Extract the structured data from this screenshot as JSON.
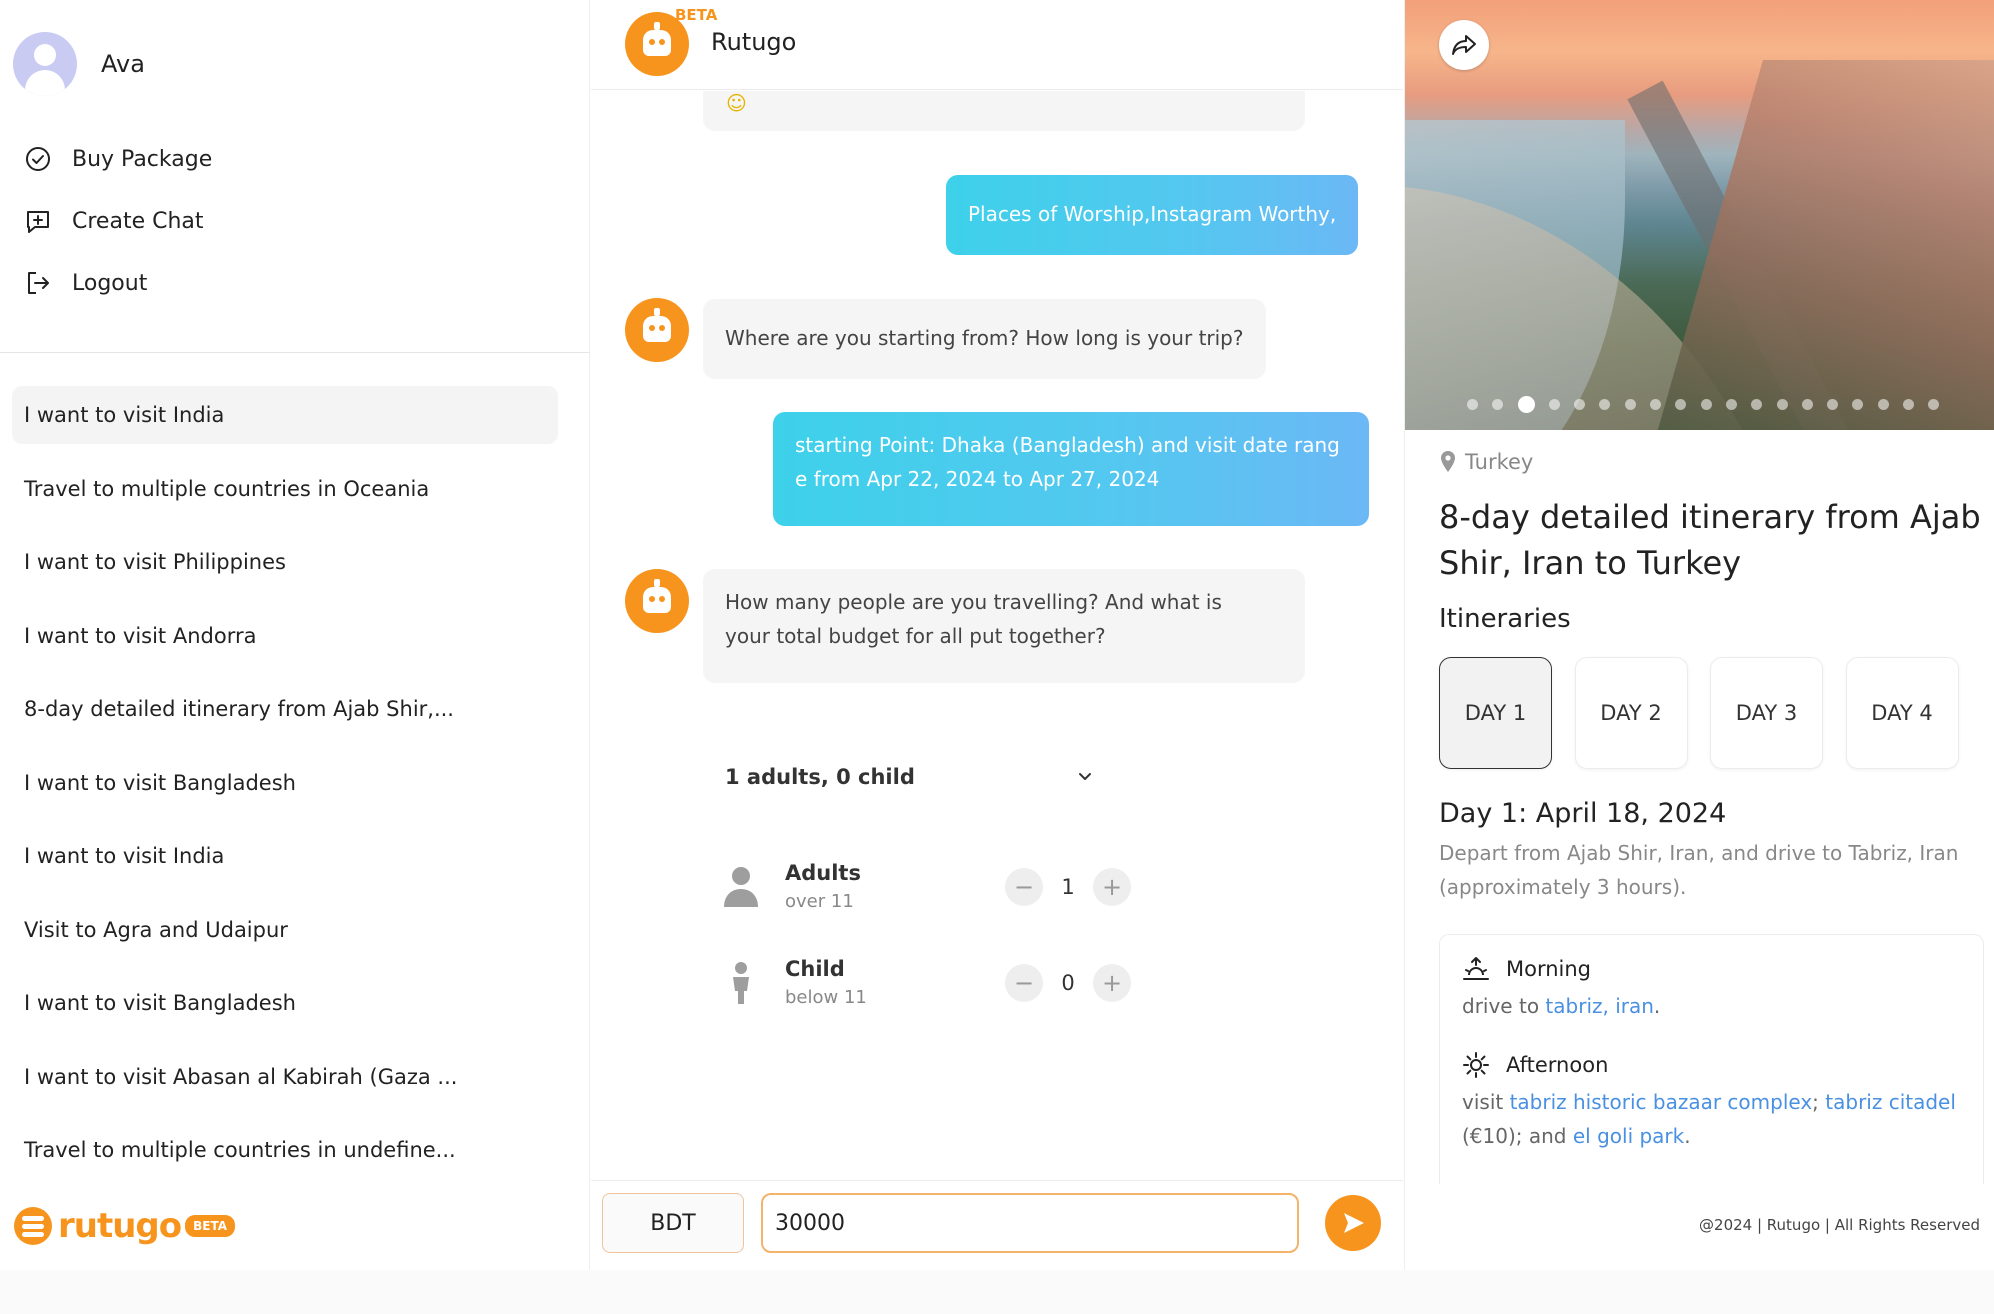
{
  "sidebar": {
    "user_name": "Ava",
    "menu": [
      {
        "label": "Buy Package",
        "icon": "check-circle-icon"
      },
      {
        "label": "Create Chat",
        "icon": "add-chat-icon"
      },
      {
        "label": "Logout",
        "icon": "logout-icon"
      }
    ],
    "chats": [
      {
        "label": "I want to visit India",
        "active": true
      },
      {
        "label": "Travel to multiple countries in Oceania"
      },
      {
        "label": "I want to visit Philippines"
      },
      {
        "label": "I want to visit Andorra"
      },
      {
        "label": "8-day detailed itinerary from Ajab Shir,..."
      },
      {
        "label": "I want to visit Bangladesh"
      },
      {
        "label": "I want to visit India"
      },
      {
        "label": "Visit to Agra and Udaipur"
      },
      {
        "label": "I want to visit Bangladesh"
      },
      {
        "label": "I want to visit Abasan al Kabirah (Gaza ..."
      },
      {
        "label": "Travel to multiple countries in undefine..."
      }
    ],
    "brand": {
      "word": "rutugo",
      "beta": "BETA",
      "color": "#f7941d"
    }
  },
  "chat": {
    "title": "Rutugo",
    "beta": "BETA",
    "emoji": "☺",
    "messages": [
      {
        "from": "user",
        "text": "Places of Worship,Instagram Worthy,"
      },
      {
        "from": "bot",
        "text": "Where are you starting from? How long is your trip?"
      },
      {
        "from": "user",
        "line1": "starting Point: Dhaka (Bangladesh) and visit date rang",
        "line2": "e from Apr 22, 2024 to Apr 27, 2024"
      },
      {
        "from": "bot",
        "line1": "How many people are you travelling? And what is",
        "line2": "your total budget for all put together?"
      }
    ],
    "travellers": {
      "summary": "1 adults, 0 child",
      "adults": {
        "title": "Adults",
        "sub": "over 11",
        "value": "1"
      },
      "child": {
        "title": "Child",
        "sub": "below 11",
        "value": "0"
      }
    },
    "composer": {
      "currency": "BDT",
      "amount": "30000"
    }
  },
  "panel": {
    "location": "Turkey",
    "title": "8-day detailed itinerary from Ajab Shir, Iran to Turkey",
    "itineraries_heading": "Itineraries",
    "days": [
      "DAY 1",
      "DAY 2",
      "DAY 3",
      "DAY 4"
    ],
    "active_day": 0,
    "carousel": {
      "count": 19,
      "active": 2
    },
    "day_heading": "Day 1: April 18, 2024",
    "day_desc": "Depart from Ajab Shir, Iran, and drive to Tabriz, Iran (approximately 3 hours).",
    "morning": {
      "label": "Morning",
      "prefix": "drive to ",
      "link": "tabriz, iran",
      "suffix": "."
    },
    "afternoon": {
      "label": "Afternoon",
      "prefix": "visit ",
      "link1": "tabriz historic bazaar complex",
      "sep": "; ",
      "link2": "tabriz citadel",
      "mid": " (€10); and ",
      "link3": "el goli park",
      "suffix": "."
    },
    "footer": "@2024 | Rutugo | All Rights Reserved",
    "link_color": "#4a90e2"
  }
}
